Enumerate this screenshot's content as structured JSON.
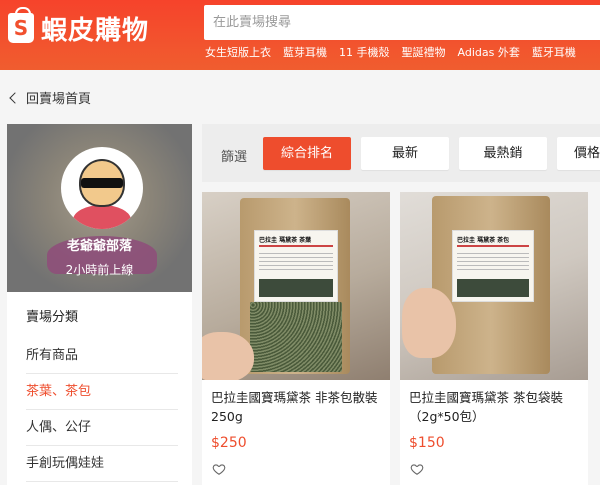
{
  "header": {
    "logo_letter": "S",
    "logo_text": "蝦皮購物",
    "search_placeholder": "在此賣場搜尋",
    "hot_keywords": [
      "女生短版上衣",
      "藍芽耳機",
      "11 手機殼",
      "聖誕禮物",
      "Adidas 外套",
      "藍牙耳機"
    ]
  },
  "breadcrumb": {
    "back_label": "回賣場首頁"
  },
  "shop": {
    "name": "老爺爺部落",
    "status": "2小時前上線"
  },
  "sidebar": {
    "title": "賣場分類",
    "items": [
      {
        "label": "所有商品",
        "active": false
      },
      {
        "label": "茶葉、茶包",
        "active": true
      },
      {
        "label": "人偶、公仔",
        "active": false
      },
      {
        "label": "手創玩偶娃娃",
        "active": false
      }
    ]
  },
  "filter": {
    "label": "篩選",
    "options": [
      {
        "label": "綜合排名",
        "active": true
      },
      {
        "label": "最新",
        "active": false
      },
      {
        "label": "最熱銷",
        "active": false
      },
      {
        "label": "價格",
        "active": false
      }
    ]
  },
  "products": [
    {
      "title": "巴拉圭國寶瑪黛茶 非茶包散裝250g",
      "price": "$250",
      "package_label": "巴拉圭 瑪黛茶 茶葉"
    },
    {
      "title": "巴拉圭國寶瑪黛茶 茶包袋裝（2g*50包）",
      "price": "$150",
      "package_label": "巴拉圭 瑪黛茶 茶包"
    }
  ],
  "colors": {
    "brand": "#ee4d2d",
    "header": "#f35530"
  },
  "icons": {
    "back": "chevron-left-icon",
    "like": "heart-icon"
  }
}
